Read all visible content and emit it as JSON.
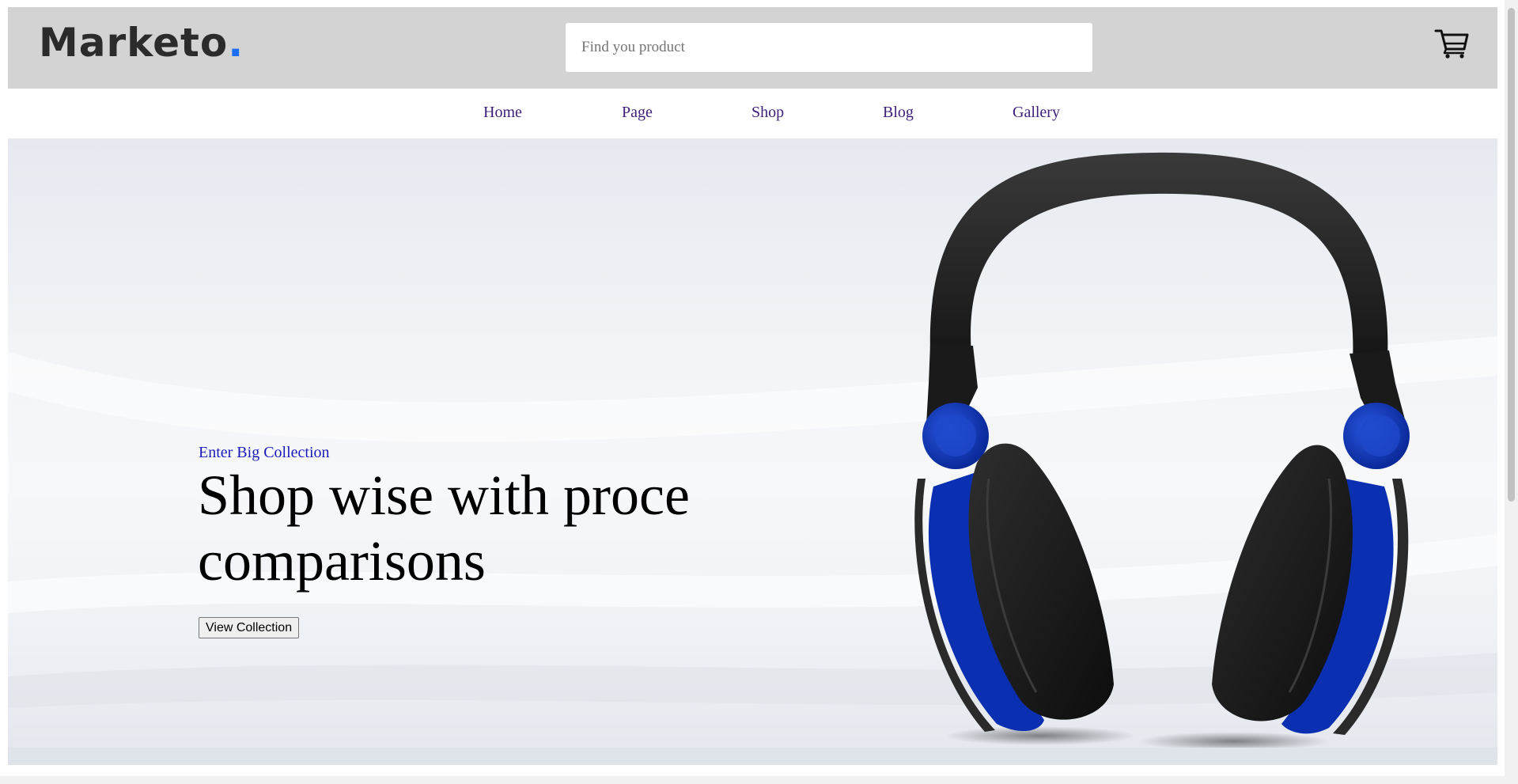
{
  "header": {
    "logo_text": "Marketo",
    "logo_dot": ".",
    "search": {
      "placeholder": "Find you product",
      "value": ""
    },
    "cart_icon": "shopping-cart-icon"
  },
  "nav": {
    "items": [
      {
        "label": "Home"
      },
      {
        "label": "Page"
      },
      {
        "label": "Shop"
      },
      {
        "label": "Blog"
      },
      {
        "label": "Gallery"
      }
    ]
  },
  "hero": {
    "eyebrow": "Enter Big Collection",
    "headline": "Shop wise with proce comparisons",
    "cta_label": "View Collection",
    "image": "headphones-image"
  },
  "colors": {
    "header_bg": "#d3d3d3",
    "logo_dot": "#1b6ff0",
    "nav_link": "#3d1f7a",
    "eyebrow": "#1a1ab8",
    "headphone_accent": "#0a2fb0"
  }
}
